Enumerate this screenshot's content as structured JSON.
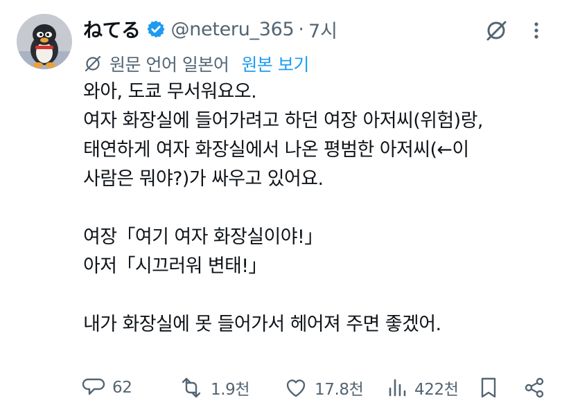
{
  "tweet": {
    "display_name": "ねてる",
    "handle": "@neteru_365",
    "separator": "·",
    "time": "7시",
    "translation": {
      "label": "원문 언어 일본어",
      "show_original": "원본 보기"
    },
    "body_lines": [
      "와아, 도쿄 무서워요오.",
      "여자 화장실에 들어가려고 하던 여장 아저씨(위험)랑,",
      "태연하게 여자 화장실에서 나온 평범한 아저씨(←이",
      "사람은 뭐야?)가 싸우고 있어요.",
      "",
      "여장「여기 여자 화장실이야!」",
      "아저「시끄러워 변태!」",
      "",
      "내가 화장실에 못 들어가서 헤어져 주면 좋겠어."
    ],
    "actions": {
      "replies": "62",
      "reposts": "1.9천",
      "likes": "17.8천",
      "views": "422천"
    }
  },
  "colors": {
    "text": "#0f1419",
    "secondary": "#536471",
    "accent": "#1d9bf0"
  },
  "icons": {
    "verified": "verified-badge-icon",
    "grok": "grok-icon",
    "more": "more-vertical-icon",
    "translate": "translate-icon",
    "reply": "reply-icon",
    "repost": "repost-icon",
    "like": "heart-icon",
    "views": "views-icon",
    "bookmark": "bookmark-icon",
    "share": "share-icon"
  }
}
